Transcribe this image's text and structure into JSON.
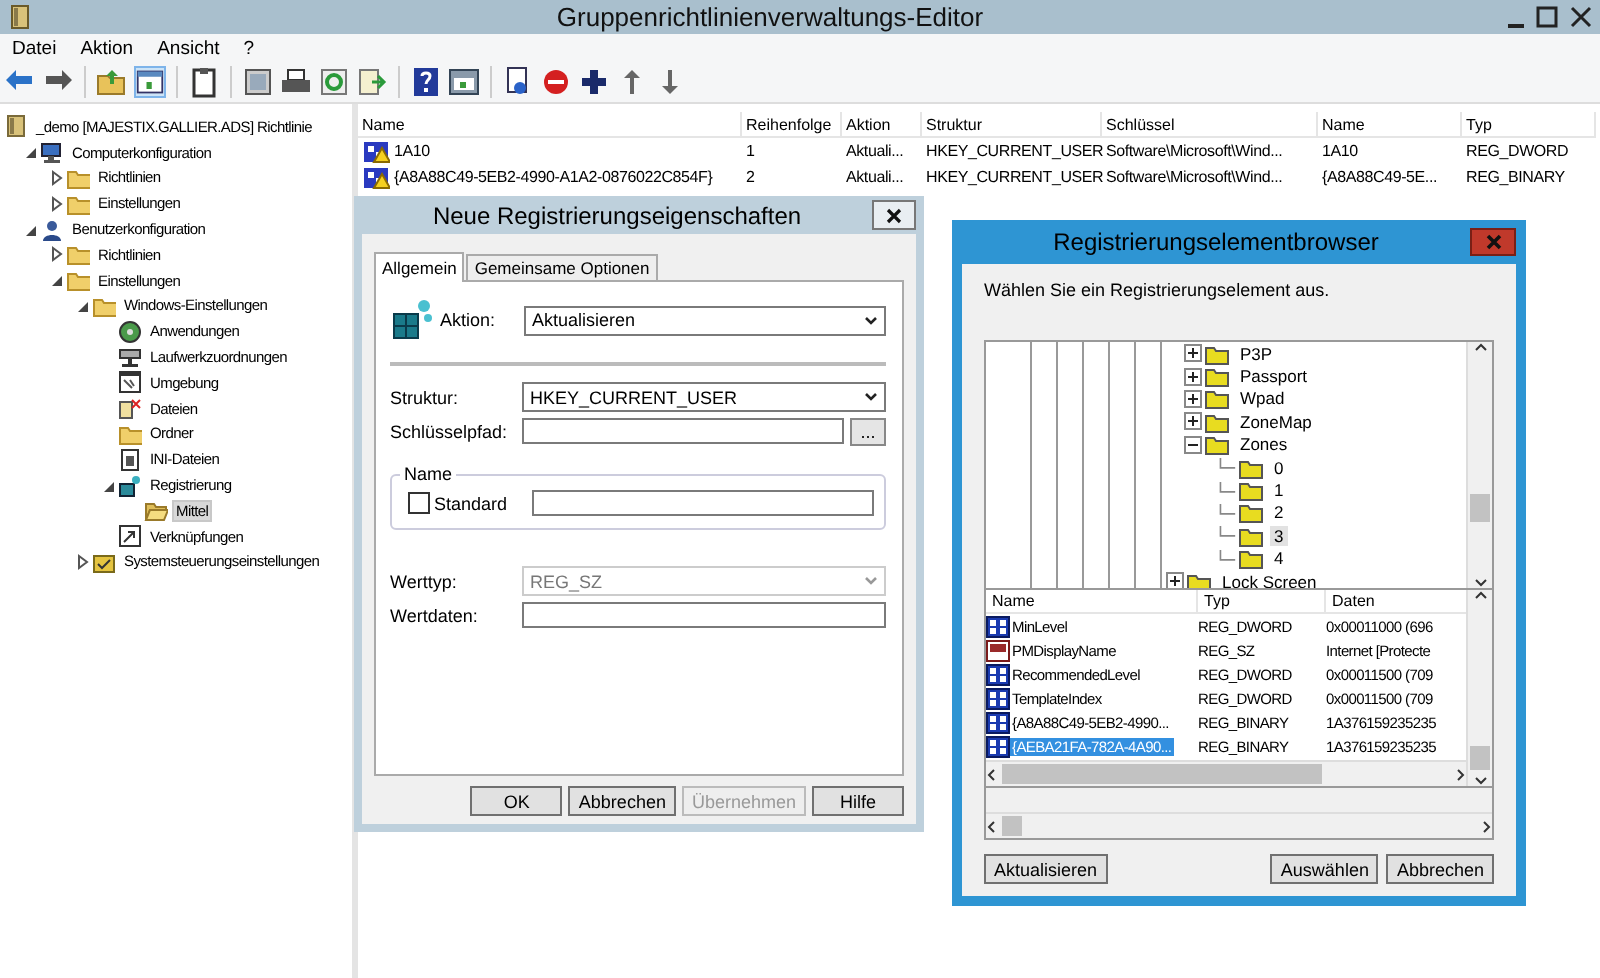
{
  "window": {
    "title": "Gruppenrichtlinienverwaltungs-Editor"
  },
  "menu": [
    "Datei",
    "Aktion",
    "Ansicht",
    "?"
  ],
  "tree": [
    {
      "label": "_demo [MAJESTIX.GALLIER.ADS] Richtlinie",
      "kind": "policy",
      "selected": false,
      "children": [
        {
          "label": "Computerkonfiguration",
          "kind": "computer",
          "expanded": true,
          "selected": false,
          "children": [
            {
              "label": "Richtlinien",
              "kind": "folder",
              "expanded": false,
              "selected": false
            },
            {
              "label": "Einstellungen",
              "kind": "folder",
              "expanded": false,
              "selected": false
            }
          ]
        },
        {
          "label": "Benutzerkonfiguration",
          "kind": "user",
          "expanded": true,
          "selected": false,
          "children": [
            {
              "label": "Richtlinien",
              "kind": "folder",
              "expanded": false,
              "selected": false
            },
            {
              "label": "Einstellungen",
              "kind": "folder",
              "expanded": true,
              "selected": false,
              "children": [
                {
                  "label": "Windows-Einstellungen",
                  "kind": "folder",
                  "expanded": true,
                  "selected": false,
                  "children": [
                    {
                      "label": "Anwendungen",
                      "kind": "disc",
                      "selected": false
                    },
                    {
                      "label": "Laufwerkzuordnungen",
                      "kind": "drive",
                      "selected": false
                    },
                    {
                      "label": "Umgebung",
                      "kind": "window",
                      "selected": false
                    },
                    {
                      "label": "Dateien",
                      "kind": "files",
                      "selected": false
                    },
                    {
                      "label": "Ordner",
                      "kind": "folder",
                      "selected": false
                    },
                    {
                      "label": "INI-Dateien",
                      "kind": "document",
                      "selected": false
                    },
                    {
                      "label": "Registrierung",
                      "kind": "registry",
                      "expanded": true,
                      "selected": false,
                      "children": [
                        {
                          "label": "Mittel",
                          "kind": "open-folder",
                          "selected": true
                        }
                      ]
                    },
                    {
                      "label": "Verknüpfungen",
                      "kind": "shortcut",
                      "selected": false
                    }
                  ]
                },
                {
                  "label": "Systemsteuerungseinstellungen",
                  "kind": "control-panel",
                  "expanded": false,
                  "selected": false
                }
              ]
            }
          ]
        }
      ]
    }
  ],
  "table": {
    "columns": [
      "Name",
      "Reihenfolge",
      "Aktion",
      "Struktur",
      "Schlüssel",
      "Name",
      "Typ"
    ],
    "rows": [
      {
        "cells": [
          "1A10",
          "1",
          "Aktuali...",
          "HKEY_CURRENT_USER",
          "Software\\Microsoft\\Wind...",
          "1A10",
          "REG_DWORD"
        ]
      },
      {
        "cells": [
          "{A8A88C49-5EB2-4990-A1A2-0876022C854F}",
          "2",
          "Aktuali...",
          "HKEY_CURRENT_USER",
          "Software\\Microsoft\\Wind...",
          "{A8A88C49-5E...",
          "REG_BINARY"
        ]
      }
    ]
  },
  "dialog": {
    "title": "Neue Registrierungseigenschaften",
    "tabs": [
      {
        "label": "Allgemein",
        "selected": true
      },
      {
        "label": "Gemeinsame Optionen",
        "selected": false
      }
    ],
    "action": {
      "label": "Aktion:",
      "value": "Aktualisieren"
    },
    "hive": {
      "label": "Struktur:",
      "value": "HKEY_CURRENT_USER"
    },
    "key_path": {
      "label": "Schlüsselpfad:",
      "browse_button": "..."
    },
    "name_group": {
      "title": "Name",
      "checkbox": {
        "label": "Standard",
        "checked": false
      }
    },
    "value_type": {
      "label": "Werttyp:",
      "value": "REG_SZ",
      "disabled": true
    },
    "value_data": {
      "label": "Wertdaten:"
    },
    "buttons": [
      {
        "label": "OK",
        "disabled": false
      },
      {
        "label": "Abbrechen",
        "disabled": false
      },
      {
        "label": "Übernehmen",
        "disabled": true
      },
      {
        "label": "Hilfe",
        "disabled": false
      }
    ]
  },
  "browser": {
    "title": "Registrierungselementbrowser",
    "instruction": "Wählen Sie ein Registrierungselement aus.",
    "tree": [
      {
        "kind": "nested",
        "children": [
          {
            "label": "P3P",
            "expanded": false,
            "selected": false
          },
          {
            "label": "Passport",
            "expanded": false,
            "selected": false
          },
          {
            "label": "Wpad",
            "expanded": false,
            "selected": false
          },
          {
            "label": "ZoneMap",
            "expanded": false,
            "selected": false
          },
          {
            "label": "Zones",
            "expanded": true,
            "selected": false,
            "children": [
              {
                "label": "0",
                "selected": false
              },
              {
                "label": "1",
                "selected": false
              },
              {
                "label": "2",
                "selected": false
              },
              {
                "label": "3",
                "selected": true
              },
              {
                "label": "4",
                "selected": false
              }
            ]
          }
        ]
      },
      {
        "kind": "item",
        "label": "Lock Screen",
        "expanded": false,
        "selected": false
      }
    ],
    "list": {
      "columns": [
        "Name",
        "Typ",
        "Daten"
      ],
      "rows": [
        {
          "kind": "binary",
          "selected": false,
          "cells": [
            "MinLevel",
            "REG_DWORD",
            "0x00011000 (696"
          ]
        },
        {
          "kind": "string",
          "selected": false,
          "cells": [
            "PMDisplayName",
            "REG_SZ",
            "Internet [Protecte"
          ]
        },
        {
          "kind": "binary",
          "selected": false,
          "cells": [
            "RecommendedLevel",
            "REG_DWORD",
            "0x00011500 (709"
          ]
        },
        {
          "kind": "binary",
          "selected": false,
          "cells": [
            "TemplateIndex",
            "REG_DWORD",
            "0x00011500 (709"
          ]
        },
        {
          "kind": "binary",
          "selected": false,
          "cells": [
            "{A8A88C49-5EB2-4990...",
            "REG_BINARY",
            "1A376159235235"
          ]
        },
        {
          "kind": "binary",
          "selected": true,
          "cells": [
            "{AEBA21FA-782A-4A90...",
            "REG_BINARY",
            "1A376159235235"
          ]
        }
      ]
    },
    "left_buttons": [
      "Aktualisieren"
    ],
    "buttons": [
      "Auswählen",
      "Abbrechen"
    ]
  }
}
